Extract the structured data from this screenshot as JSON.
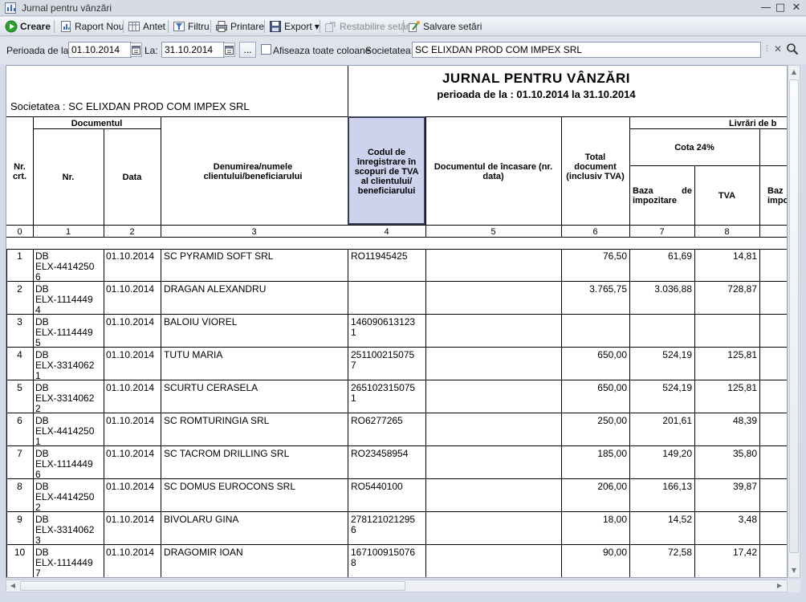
{
  "window": {
    "title": "Jurnal pentru vânzări"
  },
  "toolbar": {
    "creare": "Creare",
    "raport_nou": "Raport Nou",
    "antet": "Antet",
    "filtru": "Filtru",
    "printare": "Printare",
    "export": "Export",
    "restabilire": "Restabilire setări",
    "salvare": "Salvare setări"
  },
  "filters": {
    "perioada_label": "Perioada de la:",
    "date_from": "01.10.2014",
    "la_label": "La:",
    "date_to": "31.10.2014",
    "ellipsis": "...",
    "show_all_label": "Afiseaza toate coloane",
    "societatea_label": "Societatea:",
    "company": "SC ELIXDAN PROD COM IMPEX SRL"
  },
  "report": {
    "company_line": "Societatea :  SC ELIXDAN PROD COM IMPEX SRL",
    "title": "JURNAL PENTRU VÂNZĂRI",
    "subtitle": "perioada de la : 01.10.2014 la 31.10.2014",
    "headers": {
      "nr_crt": "Nr. crt.",
      "documentul": "Documentul",
      "nr": "Nr.",
      "data": "Data",
      "denumirea": "Denumirea/numele clientului/beneficiarului",
      "cod_tva": "Codul de înregistrare în scopuri de TVA al clientului/ beneficiarului",
      "doc_incasare": "Documentul de încasare (nr. data)",
      "total": "Total document (inclusiv TVA)",
      "livrari": "Livrări de b",
      "cota": "Cota 24%",
      "baza": "Baza de impozitare",
      "tva": "TVA",
      "baza2": "Baz impo"
    },
    "column_numbers": [
      "0",
      "1",
      "2",
      "3",
      "4",
      "5",
      "6",
      "7",
      "8"
    ],
    "rows": [
      {
        "nr": "1",
        "doc": [
          "DB",
          "ELX-4414250",
          "6"
        ],
        "data": "01.10.2014",
        "client": "SC PYRAMID SOFT SRL",
        "cod": [
          "RO11945425"
        ],
        "total": "76,50",
        "baza": "61,69",
        "tva": "14,81"
      },
      {
        "nr": "2",
        "doc": [
          "DB",
          "ELX-1114449",
          "4"
        ],
        "data": "01.10.2014",
        "client": "DRAGAN ALEXANDRU",
        "cod": [],
        "total": "3.765,75",
        "baza": "3.036,88",
        "tva": "728,87"
      },
      {
        "nr": "3",
        "doc": [
          "DB",
          "ELX-1114449",
          "5"
        ],
        "data": "01.10.2014",
        "client": "BALOIU VIOREL",
        "cod": [
          "146090613123",
          "1"
        ],
        "total": "",
        "baza": "",
        "tva": ""
      },
      {
        "nr": "4",
        "doc": [
          "DB",
          "ELX-3314062",
          "1"
        ],
        "data": "01.10.2014",
        "client": "TUTU MARIA",
        "cod": [
          "251100215075",
          "7"
        ],
        "total": "650,00",
        "baza": "524,19",
        "tva": "125,81"
      },
      {
        "nr": "5",
        "doc": [
          "DB",
          "ELX-3314062",
          "2"
        ],
        "data": "01.10.2014",
        "client": "SCURTU CERASELA",
        "cod": [
          "265102315075",
          "1"
        ],
        "total": "650,00",
        "baza": "524,19",
        "tva": "125,81"
      },
      {
        "nr": "6",
        "doc": [
          "DB",
          "ELX-4414250",
          "1"
        ],
        "data": "01.10.2014",
        "client": "SC ROMTURINGIA SRL",
        "cod": [
          "RO6277265"
        ],
        "total": "250,00",
        "baza": "201,61",
        "tva": "48,39"
      },
      {
        "nr": "7",
        "doc": [
          "DB",
          "ELX-1114449",
          "6"
        ],
        "data": "01.10.2014",
        "client": "SC TACROM DRILLING SRL",
        "cod": [
          "RO23458954"
        ],
        "total": "185,00",
        "baza": "149,20",
        "tva": "35,80"
      },
      {
        "nr": "8",
        "doc": [
          "DB",
          "ELX-4414250",
          "2"
        ],
        "data": "01.10.2014",
        "client": "SC DOMUS EUROCONS SRL",
        "cod": [
          "RO5440100"
        ],
        "total": "206,00",
        "baza": "166,13",
        "tva": "39,87"
      },
      {
        "nr": "9",
        "doc": [
          "DB",
          "ELX-3314062",
          "3"
        ],
        "data": "01.10.2014",
        "client": "BIVOLARU GINA",
        "cod": [
          "278121021295",
          "6"
        ],
        "total": "18,00",
        "baza": "14,52",
        "tva": "3,48"
      },
      {
        "nr": "10",
        "doc": [
          "DB",
          "ELX-1114449",
          "7"
        ],
        "data": "01.10.2014",
        "client": "DRAGOMIR IOAN",
        "cod": [
          "167100915076",
          "8"
        ],
        "total": "90,00",
        "baza": "72,58",
        "tva": "17,42"
      }
    ]
  }
}
